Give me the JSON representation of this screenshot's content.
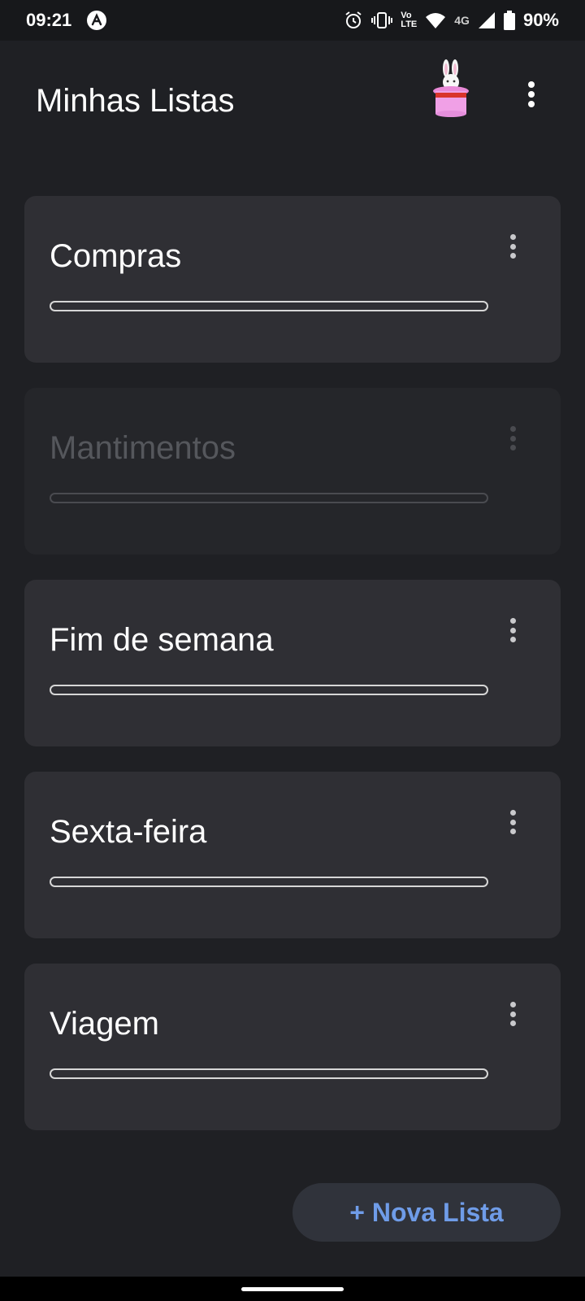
{
  "status_bar": {
    "time": "09:21",
    "network": "4G",
    "volte_top": "Vo",
    "volte_bottom": "LTE",
    "battery": "90%"
  },
  "app_bar": {
    "title": "Minhas Listas"
  },
  "lists": [
    {
      "title": "Compras",
      "progress": 0,
      "disabled": false
    },
    {
      "title": "Mantimentos",
      "progress": 0,
      "disabled": true
    },
    {
      "title": "Fim de semana",
      "progress": 0,
      "disabled": false
    },
    {
      "title": "Sexta-feira",
      "progress": 0,
      "disabled": false
    },
    {
      "title": "Viagem",
      "progress": 0,
      "disabled": false
    }
  ],
  "fab": {
    "label": "+ Nova Lista"
  },
  "icons": {
    "app_bar": [
      "magic-hat-rabbit-icon",
      "more-vert-icon"
    ],
    "status_left": [
      "app-notification-icon"
    ],
    "status_right": [
      "alarm-icon",
      "vibrate-icon",
      "volte-icon",
      "wifi-icon",
      "cell-signal-icon",
      "battery-icon"
    ]
  },
  "colors": {
    "background": "#1f2024",
    "card": "#2f2f34",
    "card_disabled": "#25262a",
    "accent": "#6f9ce8"
  }
}
